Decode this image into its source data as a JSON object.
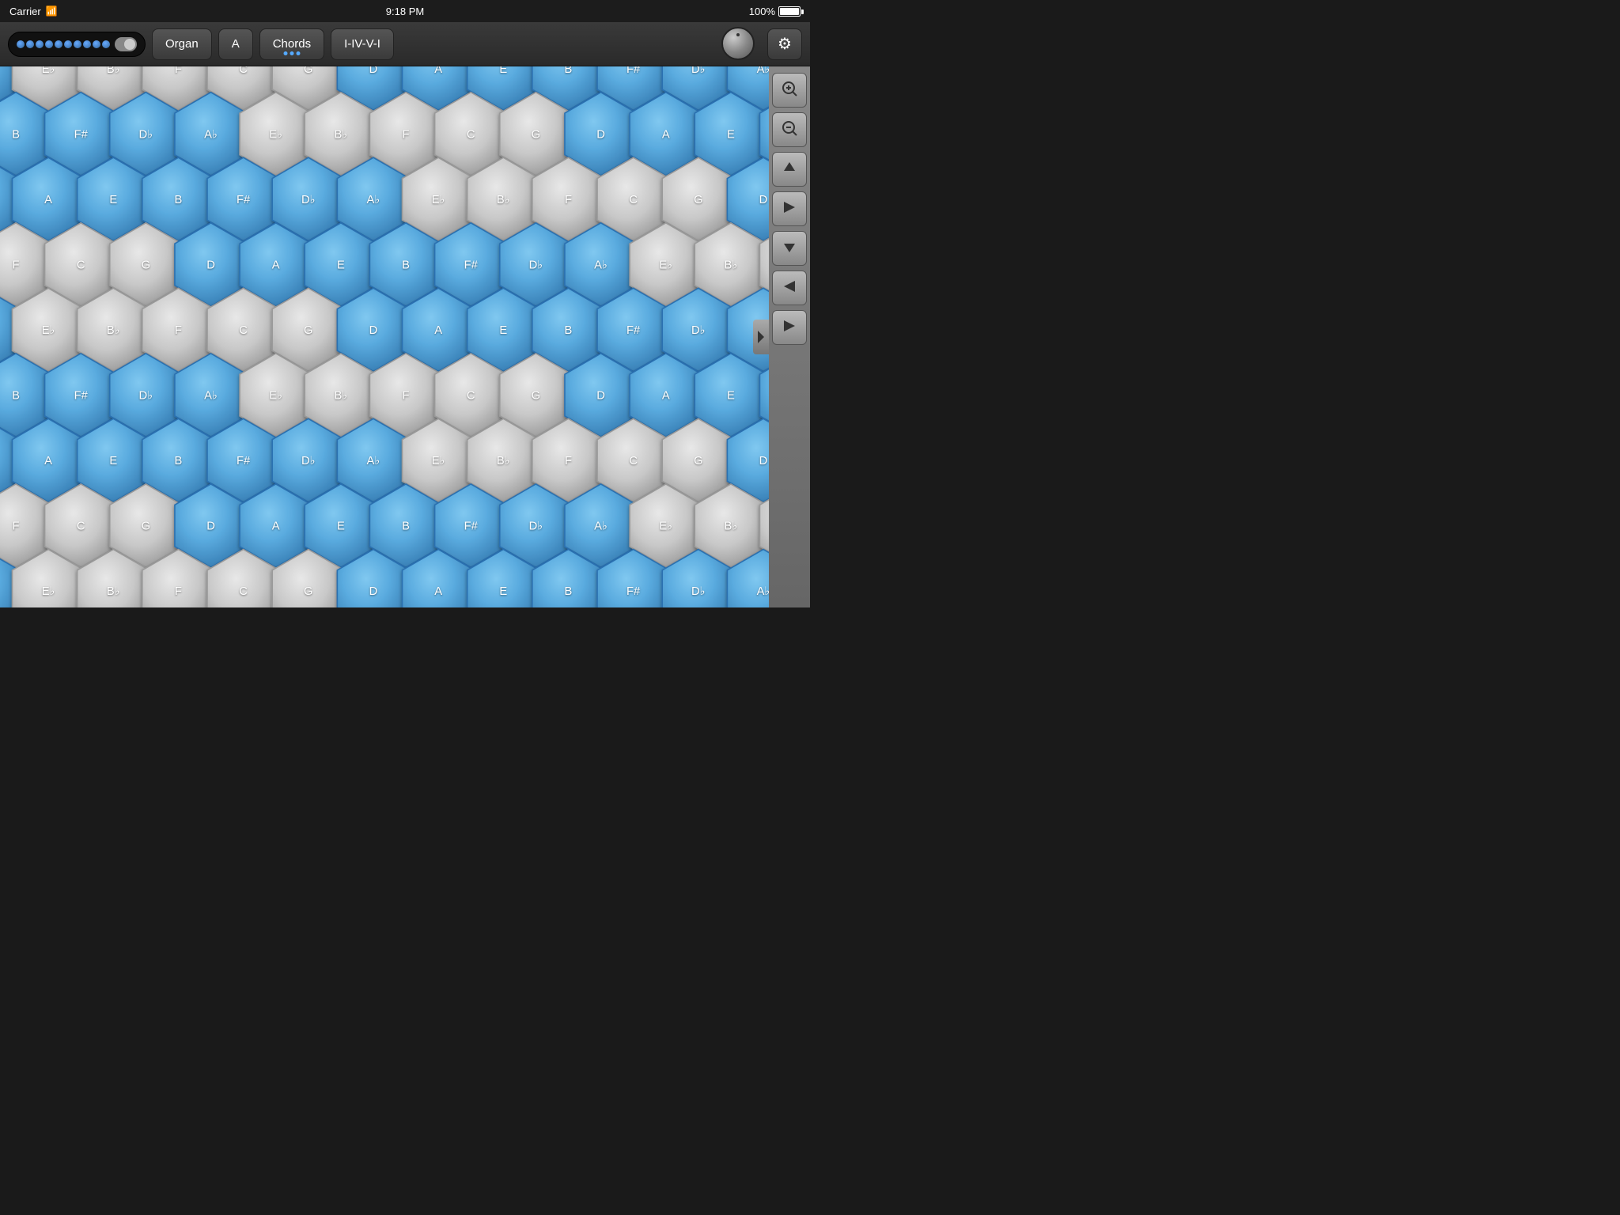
{
  "statusBar": {
    "carrier": "Carrier",
    "time": "9:18 PM",
    "battery": "100%"
  },
  "toolbar": {
    "organ_label": "Organ",
    "key_label": "A",
    "chords_label": "Chords",
    "progression_label": "I-IV-V-I",
    "gear_icon": "⚙"
  },
  "sidePanel": {
    "zoom_in": "+",
    "zoom_out": "−",
    "arrow_up": "▲",
    "arrow_right": "▶",
    "arrow_down": "▼",
    "arrow_left": "◀",
    "arrow_right2": "▶"
  },
  "hexGrid": {
    "rows": [
      {
        "offset": 0,
        "cells": [
          {
            "note": "A♭",
            "blue": false
          },
          {
            "note": "B♭",
            "blue": false
          },
          {
            "note": "B",
            "blue": false
          },
          {
            "note": "C",
            "blue": false
          },
          {
            "note": "D♭",
            "blue": true
          },
          {
            "note": "D",
            "blue": false
          },
          {
            "note": "E♭",
            "blue": false
          }
        ]
      },
      {
        "offset": 1,
        "cells": [
          {
            "note": "A",
            "blue": true
          },
          {
            "note": "B♭",
            "blue": false
          },
          {
            "note": "B",
            "blue": false
          },
          {
            "note": "C",
            "blue": false
          },
          {
            "note": "D♭",
            "blue": false
          },
          {
            "note": "D",
            "blue": false
          },
          {
            "note": "E♭",
            "blue": false
          }
        ]
      }
    ],
    "blue_notes": [
      "A",
      "E",
      "D♭",
      "A♭",
      "F",
      "C"
    ]
  }
}
